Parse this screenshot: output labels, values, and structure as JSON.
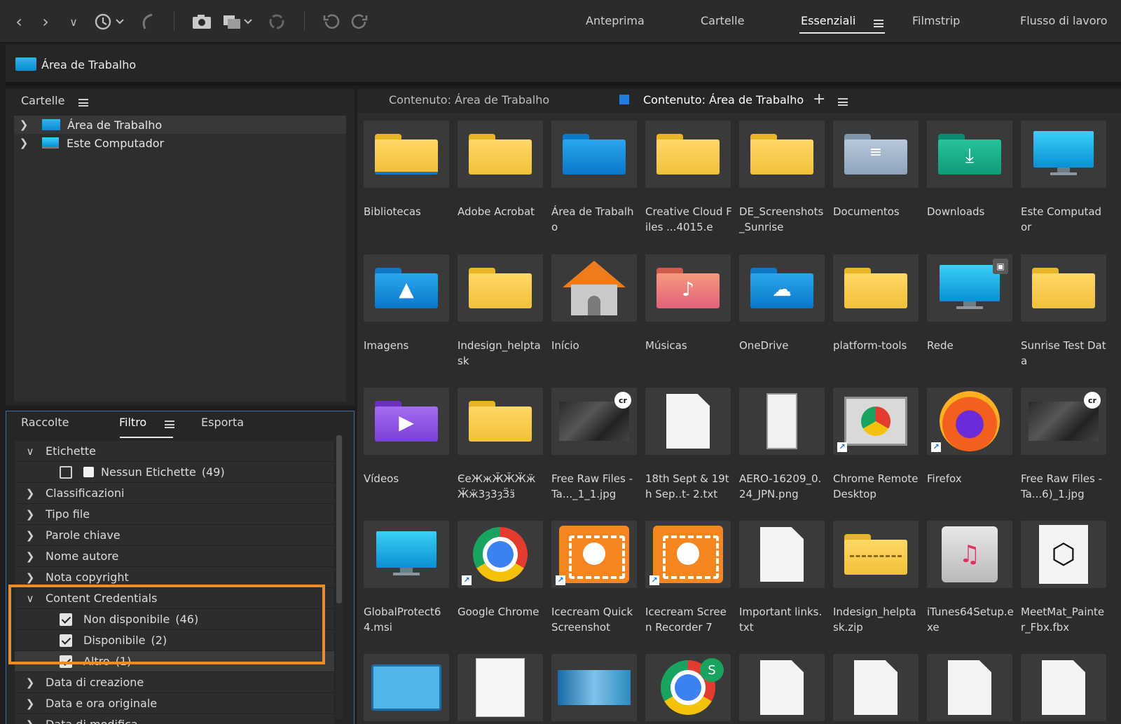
{
  "toolbar": {
    "icons": [
      "back-icon",
      "forward-icon",
      "dropdown-chevron-icon",
      "history-icon",
      "reveal-recent-icon",
      "get-photos-icon",
      "batch-rename-icon",
      "refresh-icon",
      "rotate-left-icon",
      "rotate-right-icon"
    ],
    "workspaces": [
      {
        "label": "Anteprima"
      },
      {
        "label": "Cartelle"
      },
      {
        "label": "Essenziali"
      },
      {
        "label": "Filmstrip"
      },
      {
        "label": "Flusso di lavoro"
      }
    ],
    "active_workspace": "Essenziali"
  },
  "path": {
    "label": "Área de Trabalho"
  },
  "folders_panel": {
    "title": "Cartelle",
    "items": [
      {
        "label": "Área de Trabalho"
      },
      {
        "label": "Este Computador"
      }
    ]
  },
  "lower_panel": {
    "tabs": [
      {
        "label": "Raccolte"
      },
      {
        "label": "Filtro"
      },
      {
        "label": "Esporta"
      }
    ],
    "active_tab": "Filtro",
    "filter_rows": [
      {
        "label": "Etichette"
      },
      {
        "label": "Nessun Etichette",
        "count": "(49)"
      },
      {
        "label": "Classificazioni"
      },
      {
        "label": "Tipo file"
      },
      {
        "label": "Parole chiave"
      },
      {
        "label": "Nome autore"
      },
      {
        "label": "Nota copyright"
      },
      {
        "label": "Content Credentials"
      },
      {
        "label": "Non disponibile",
        "count": "(46)"
      },
      {
        "label": "Disponibile",
        "count": "(2)"
      },
      {
        "label": "Altro",
        "count": "(1)"
      },
      {
        "label": "Data di creazione"
      },
      {
        "label": "Data e ora originale"
      },
      {
        "label": "Data di modifica"
      }
    ]
  },
  "content": {
    "tabs": [
      {
        "label": "Contenuto: Área de Trabalho"
      },
      {
        "label": "Contenuto: Área de Trabalho"
      }
    ],
    "items": [
      {
        "label": "Bibliotecas"
      },
      {
        "label": "Adobe Acrobat"
      },
      {
        "label": "Área de Trabalho"
      },
      {
        "label": "Creative Cloud Files ...4015.e"
      },
      {
        "label": "DE_Screenshots_Sunrise"
      },
      {
        "label": "Documentos"
      },
      {
        "label": "Downloads"
      },
      {
        "label": "Este Computador"
      },
      {
        "label": "Imagens"
      },
      {
        "label": "Indesign_helptask"
      },
      {
        "label": "Início"
      },
      {
        "label": "Músicas"
      },
      {
        "label": "OneDrive"
      },
      {
        "label": "platform-tools"
      },
      {
        "label": "Rede"
      },
      {
        "label": "Sunrise Test Data"
      },
      {
        "label": "Vídeos"
      },
      {
        "label": "ЄеЖжӁӁӜӝ Ӝӝ3ȝ3ȝӞӟ"
      },
      {
        "label": "Free Raw Files - Ta..._1_1.jpg"
      },
      {
        "label": "18th Sept & 19th Sep..t- 2.txt"
      },
      {
        "label": "AERO-16209_0.24_JPN.png"
      },
      {
        "label": "Chrome Remote Desktop"
      },
      {
        "label": "Firefox"
      },
      {
        "label": "Free Raw Files - Ta...6)_1.jpg"
      },
      {
        "label": "GlobalProtect64.msi"
      },
      {
        "label": "Google Chrome"
      },
      {
        "label": "Icecream Quick Screenshot"
      },
      {
        "label": "Icecream Screen Recorder 7"
      },
      {
        "label": "Important links.txt"
      },
      {
        "label": "Indesign_helptask.zip"
      },
      {
        "label": "iTunes64Setup.exe"
      },
      {
        "label": "MeetMat_Painter_Fbx.fbx"
      },
      {
        "label": ""
      },
      {
        "label": ""
      },
      {
        "label": ""
      },
      {
        "label": ""
      },
      {
        "label": ""
      },
      {
        "label": ""
      },
      {
        "label": ""
      },
      {
        "label": ""
      }
    ],
    "badges": {
      "cr": "cr",
      "shortcut": "↗",
      "s": "S"
    }
  },
  "colors": {
    "accent_orange": "#f08a24",
    "folder_yellow": "#f2c13a",
    "selection_blue": "#1f7fe0"
  }
}
